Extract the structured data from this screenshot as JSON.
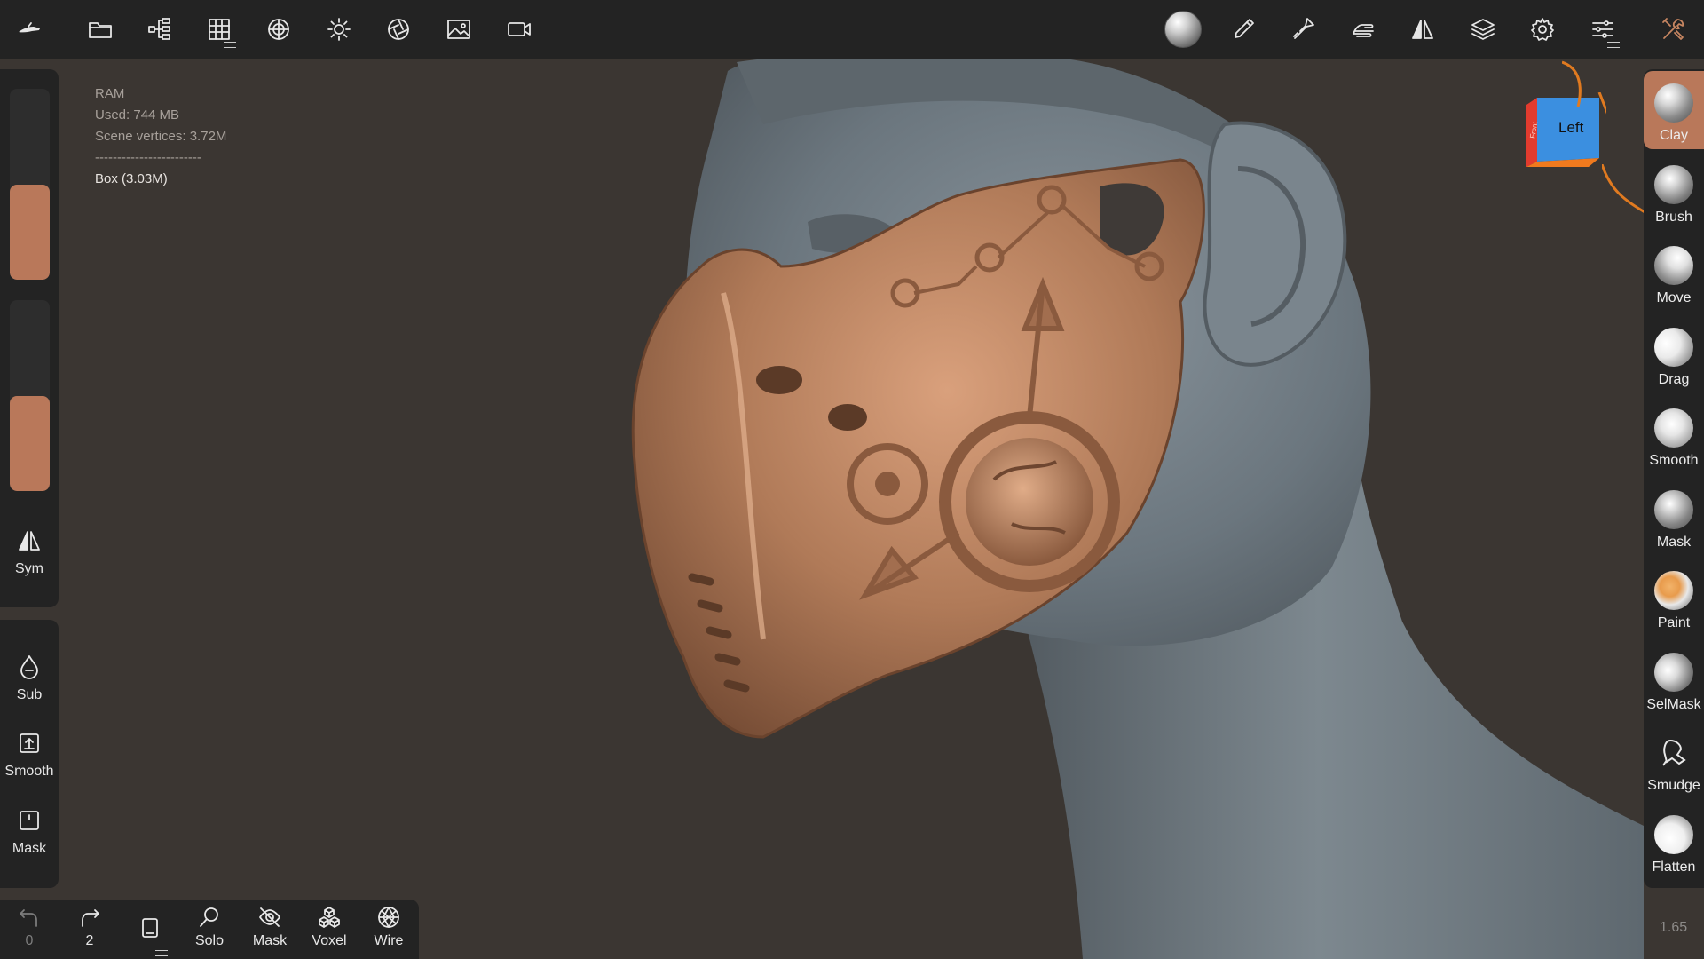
{
  "top_toolbar": {
    "left_icons": [
      "app-logo-icon",
      "folder-icon",
      "scene-tree-icon",
      "grid-icon",
      "matcap-sphere-icon",
      "light-icon",
      "aperture-icon",
      "image-icon",
      "video-icon"
    ],
    "right_icons": [
      "material-sphere-icon",
      "paint-brush-icon",
      "stroke-brush-icon",
      "hand-gesture-icon",
      "symmetry-icon",
      "layers-icon",
      "settings-icon",
      "sliders-icon",
      "tools-icon"
    ]
  },
  "info": {
    "ram_label": "RAM",
    "used": "Used: 744 MB",
    "vertices": "Scene vertices: 3.72M",
    "separator": "------------------------",
    "object": "Box (3.03M)"
  },
  "left_panel": {
    "slider_radius_fill": 0.5,
    "slider_intensity_fill": 0.5,
    "sym_label": "Sym",
    "sub_label": "Sub",
    "smooth_label": "Smooth",
    "mask_label": "Mask"
  },
  "right_tools": [
    {
      "label": "Clay",
      "active": true
    },
    {
      "label": "Brush",
      "active": false
    },
    {
      "label": "Move",
      "active": false
    },
    {
      "label": "Drag",
      "active": false
    },
    {
      "label": "Smooth",
      "active": false
    },
    {
      "label": "Mask",
      "active": false
    },
    {
      "label": "Paint",
      "active": false
    },
    {
      "label": "SelMask",
      "active": false
    },
    {
      "label": "Smudge",
      "active": false
    },
    {
      "label": "Flatten",
      "active": false
    }
  ],
  "bottom_bar": {
    "undo_count": "0",
    "redo_count": "2",
    "solo_label": "Solo",
    "mask_label": "Mask",
    "voxel_label": "Voxel",
    "wire_label": "Wire"
  },
  "view_cube": {
    "face_label": "Left",
    "side_label": "Front"
  },
  "zoom_value": "1.65",
  "colors": {
    "accent": "#b9785a",
    "panel": "#232323",
    "background": "#3b3632",
    "copper": "#b07a58",
    "skin": "#6f7a82"
  }
}
